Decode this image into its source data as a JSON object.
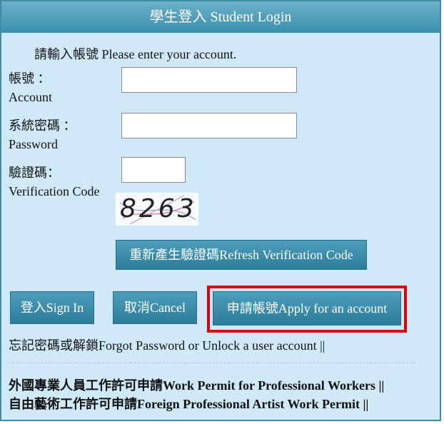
{
  "header": {
    "title": "學生登入 Student Login"
  },
  "form": {
    "prompt": "請輸入帳號 Please enter your account.",
    "account_label_zh": "帳號 ：",
    "account_label_en": "Account",
    "password_label_zh": "系統密碼 ：",
    "password_label_en": "Password",
    "code_label_zh": "驗證碼：",
    "code_label_en": "Verification Code",
    "captcha": "8263",
    "refresh_label": "重新產生驗證碼Refresh Verification Code"
  },
  "actions": {
    "signin_label": "登入Sign In",
    "cancel_label": "取消Cancel",
    "apply_label": "申請帳號Apply for an account"
  },
  "links": {
    "forgot": "忘記密碼或解鎖Forgot Password or Unlock a user account ||",
    "work_permit": "外國專業人員工作許可申請Work Permit for Professional Workers ||",
    "artist_permit": "自由藝術工作許可申請Foreign Professional Artist Work Permit ||"
  },
  "colors": {
    "header": "#3b8fae",
    "panel": "#cfe9f8",
    "button": "#2d7c9a",
    "highlight": "#e00000"
  }
}
